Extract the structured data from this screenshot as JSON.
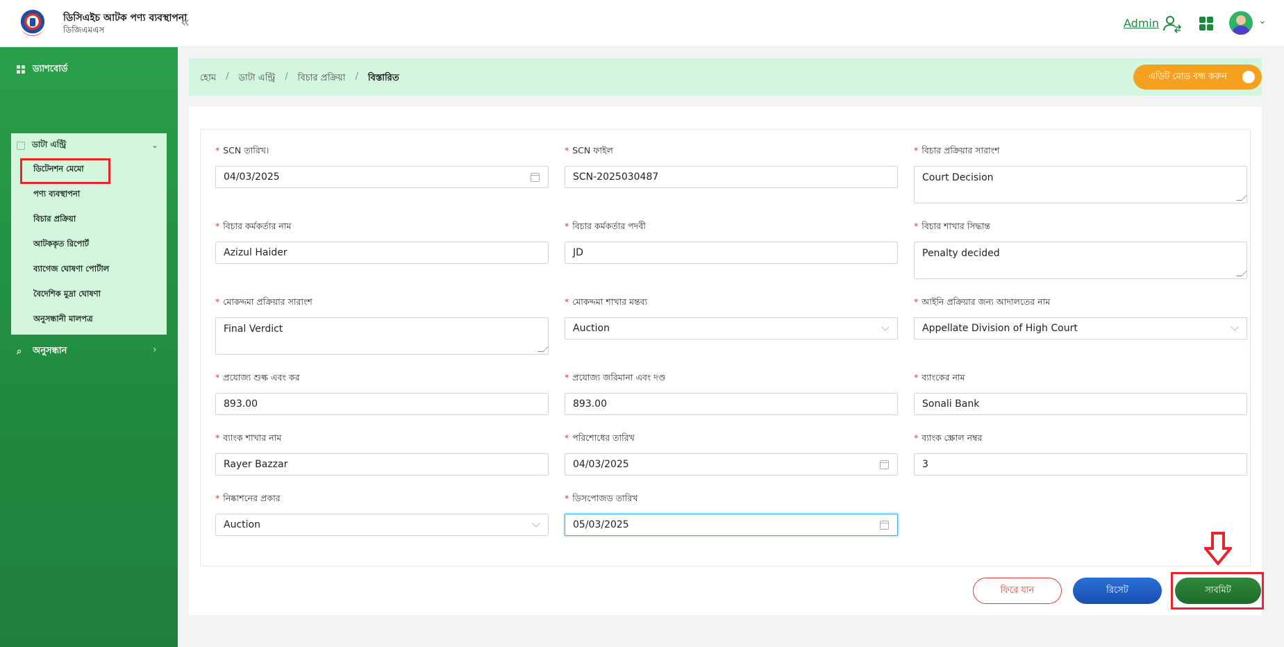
{
  "header": {
    "title": "ডিসিএইচ আটক পণ্য ব্যবস্থাপনা",
    "subtitle": "ডিজিএমএস",
    "admin_label": "Admin"
  },
  "sidebar": {
    "dashboard": "ড্যাশবোর্ড",
    "data_entry": "ডাটা এন্ট্রি",
    "sub_items": [
      "ডিটেনশন মেমো",
      "পণ্য ব্যবস্থাপনা",
      "বিচার প্রক্রিয়া",
      "আটককৃত রিপোর্ট",
      "ব্যাগেজ ঘোষণা পোর্টাল",
      "বৈদেশিক মুদ্রা ঘোষণা",
      "অনুসন্ধানী মালপত্র"
    ],
    "search": "অনুসন্ধান"
  },
  "breadcrumb": {
    "items": [
      "হোম",
      "ডাটা এন্ট্রি",
      "বিচার প্রক্রিয়া"
    ],
    "current": "বিস্তারিত",
    "separator": "/"
  },
  "edit_toggle_label": "এডিট মোড বন্ধ করুন",
  "form": {
    "scn_date": {
      "label": "SCN তারিখ।",
      "value": "04/03/2025"
    },
    "scn_file": {
      "label": "SCN ফাইল",
      "value": "SCN-2025030487"
    },
    "trial_summary": {
      "label": "বিচার প্রক্রিয়ার সারাংশ",
      "value": "Court Decision"
    },
    "officer_name": {
      "label": "বিচার কর্মকর্তার নাম",
      "value": "Azizul Haider"
    },
    "officer_designation": {
      "label": "বিচার কর্মকর্তার পদবী",
      "value": "JD"
    },
    "branch_decision": {
      "label": "বিচার শাখার সিদ্ধান্ত",
      "value": "Penalty decided"
    },
    "case_summary": {
      "label": "মোকদ্দমা প্রক্রিয়ার সারাংশ",
      "value": "Final Verdict"
    },
    "case_branch_comment": {
      "label": "মোকদ্দমা শাখার মন্তব্য",
      "value": "Auction"
    },
    "court_name": {
      "label": "আইনি প্রক্রিয়ার জন্য আদালতের নাম",
      "value": "Appellate Division of High Court"
    },
    "duty_tax": {
      "label": "প্রযোজ্য শুল্ক এবং কর",
      "value": "893.00"
    },
    "fine_penalty": {
      "label": "প্রযোজ্য জরিমানা এবং দণ্ড",
      "value": "893.00"
    },
    "bank_name": {
      "label": "ব্যাংকের নাম",
      "value": "Sonali Bank"
    },
    "bank_branch": {
      "label": "ব্যাংক শাখার নাম",
      "value": "Rayer Bazzar"
    },
    "payment_date": {
      "label": "পরিশোধের তারিখ",
      "value": "04/03/2025"
    },
    "bank_scroll": {
      "label": "ব্যাংক স্ক্রোল নম্বর",
      "value": "3"
    },
    "disposal_type": {
      "label": "নিষ্কাশনের প্রকার",
      "value": "Auction"
    },
    "disposal_date": {
      "label": "ডিসপোজড তারিখ",
      "value": "05/03/2025"
    }
  },
  "buttons": {
    "back": "ফিরে যান",
    "reset": "রিসেট",
    "submit": "সাবমিট"
  },
  "colors": {
    "brand_green": "#1f8a3e",
    "edit_toggle": "#f5a01e",
    "annotation_red": "#e8262a"
  }
}
